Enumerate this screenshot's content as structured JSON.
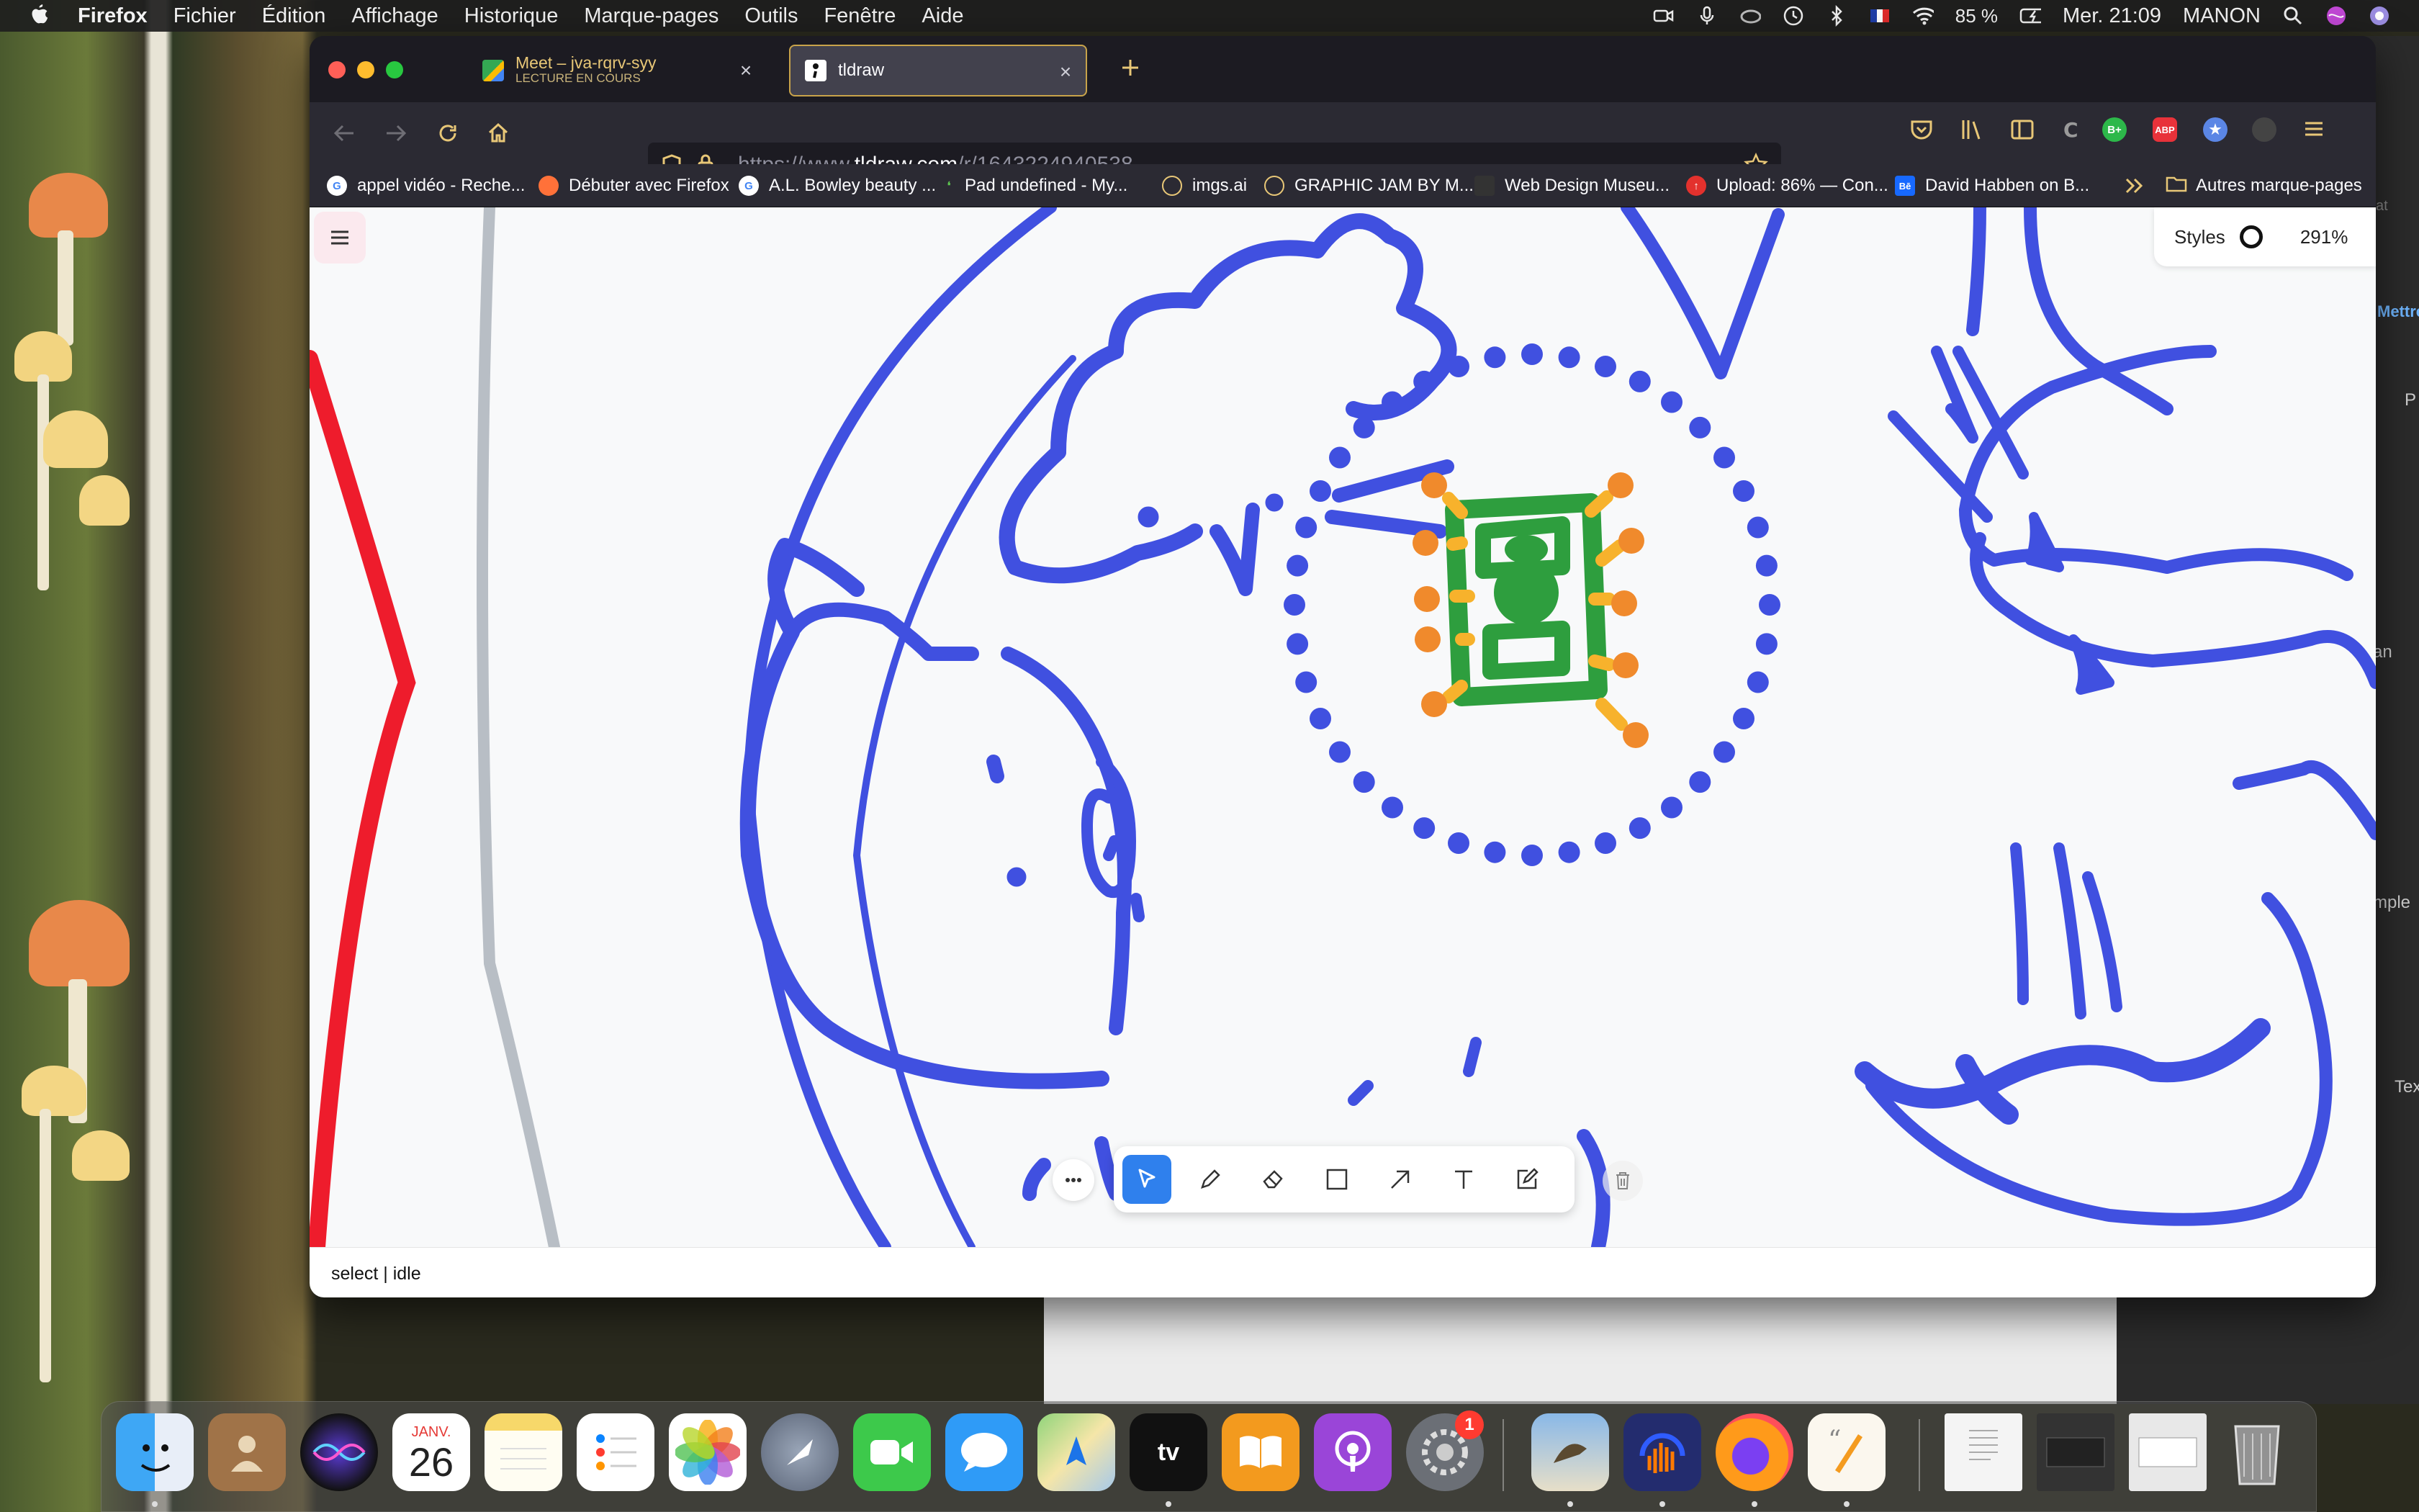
{
  "menubar": {
    "app_name": "Firefox",
    "items": [
      "Fichier",
      "Édition",
      "Affichage",
      "Historique",
      "Marque-pages",
      "Outils",
      "Fenêtre",
      "Aide"
    ],
    "battery": "85 %",
    "clock": "Mer. 21:09",
    "user": "MANON"
  },
  "tabs": [
    {
      "title": "Meet – jva-rqrv-syy",
      "subtitle": "LECTURE EN COURS",
      "active": false
    },
    {
      "title": "tldraw",
      "active": true
    }
  ],
  "address_bar": {
    "url_prefix": "https://www.",
    "url_domain": "tldraw.com",
    "url_path": "/r/1643224940538"
  },
  "bookmarks": [
    {
      "label": "appel vidéo - Reche...",
      "icon": "google-icon"
    },
    {
      "label": "Débuter avec Firefox",
      "icon": "firefox-icon"
    },
    {
      "label": "A.L. Bowley beauty ...",
      "icon": "google-icon"
    },
    {
      "label": "Pad undefined - My...",
      "icon": "leaf-icon"
    },
    {
      "label": "imgs.ai",
      "icon": "globe-icon"
    },
    {
      "label": "GRAPHIC JAM BY M...",
      "icon": "globe-icon"
    },
    {
      "label": "Web Design Museu...",
      "icon": "museum-icon"
    },
    {
      "label": "Upload: 86% — Con...",
      "icon": "upload-icon"
    },
    {
      "label": "David Habben on B...",
      "icon": "behance-icon"
    }
  ],
  "bookmarks_folder": "Autres marque-pages",
  "tldraw": {
    "styles_label": "Styles",
    "zoom": "291%",
    "status": "select | idle",
    "tools": [
      "select",
      "pencil",
      "eraser",
      "rectangle",
      "arrow",
      "text",
      "sticky-note"
    ]
  },
  "dock": {
    "calendar_month": "JANV.",
    "calendar_day": "26",
    "settings_badge": "1"
  },
  "right_panel": {
    "label_mettre": "Mettre",
    "label_p": "P",
    "label_an": "an",
    "label_mple": "mple",
    "label_tex": "Tex",
    "label_at": "at"
  },
  "colors": {
    "canvas_bg": "#f8f9fa",
    "blue_ink": "#4050e0",
    "green_ink": "#2e9e3e",
    "orange_handle": "#f08a2c",
    "red_ink": "#ee1c2c",
    "grey_ink": "#b8bec5",
    "select_blue": "#2f80ed",
    "tab_border": "#c8a34a"
  }
}
